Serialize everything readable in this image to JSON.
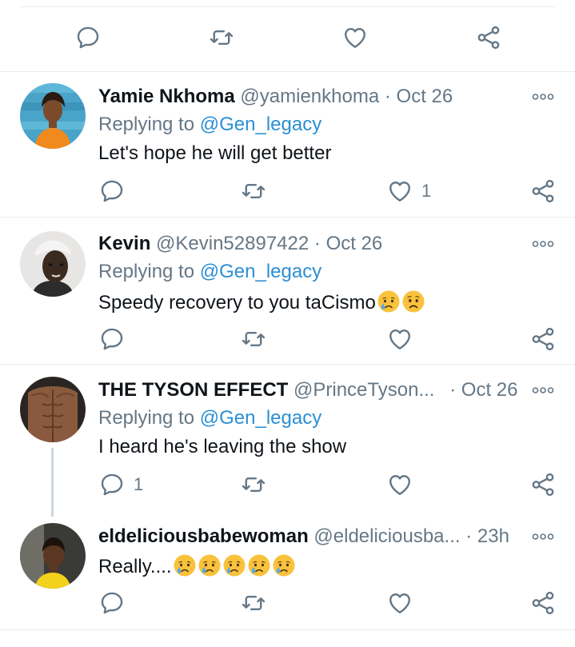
{
  "top_actions": {
    "reply_icon": "reply-icon",
    "retweet_icon": "retweet-icon",
    "like_icon": "heart-icon",
    "share_icon": "share-icon"
  },
  "replies": [
    {
      "name": "Yamie Nkhoma",
      "handle": "@yamienkhoma",
      "separator": "·",
      "time": "Oct 26",
      "replying_prefix": "Replying to",
      "replying_to": "@Gen_legacy",
      "text": "Let's hope he will get better",
      "reply_count": "",
      "like_count": "1"
    },
    {
      "name": "Kevin",
      "handle": "@Kevin52897422",
      "separator": "·",
      "time": "Oct 26",
      "replying_prefix": "Replying to",
      "replying_to": "@Gen_legacy",
      "text": "Speedy recovery to you taCismo",
      "emojis": [
        "crying-face",
        "worried-face"
      ],
      "reply_count": "",
      "like_count": ""
    },
    {
      "name": "THE TYSON EFFECT",
      "handle": "@PrinceTyson...",
      "separator": "·",
      "time": "Oct 26",
      "replying_prefix": "Replying to",
      "replying_to": "@Gen_legacy",
      "text": "I heard he's leaving the show",
      "reply_count": "1",
      "like_count": ""
    },
    {
      "name": "eldeliciousbabewoman",
      "handle": "@eldeliciousba...",
      "separator": "·",
      "time": "23h",
      "text": "Really....",
      "emojis": [
        "crying-face",
        "crying-face",
        "crying-face",
        "crying-face",
        "crying-face"
      ],
      "reply_count": "",
      "like_count": ""
    }
  ],
  "colors": {
    "text_primary": "#0f1419",
    "text_secondary": "#657786",
    "mention": "#2b8fd4",
    "divider": "#e6ecf0"
  }
}
